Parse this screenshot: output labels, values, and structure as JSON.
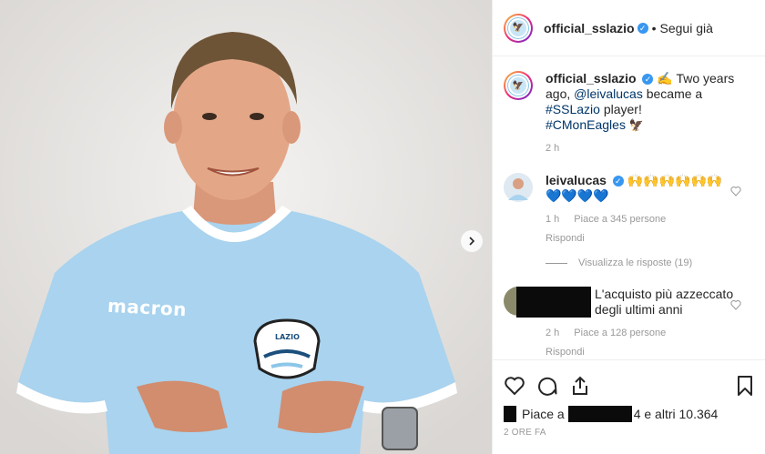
{
  "header": {
    "username": "official_sslazio",
    "separator": "•",
    "follow_status": "Segui già",
    "verified_mark": "✓"
  },
  "photo": {
    "shirt_brand": "macron",
    "crest_text": "LAZIO"
  },
  "caption": {
    "username": "official_sslazio",
    "text_1": "✍️ Two years ago,",
    "mention": "@leivalucas",
    "text_2": " became a ",
    "hashtag_1": "#SSLazio",
    "text_3": " player!",
    "hashtag_2": "#CMonEagles",
    "emoji_end": "🦅",
    "time": "2 h"
  },
  "comments": [
    {
      "username": "leivalucas",
      "text": "🙌🙌🙌🙌🙌🙌 💙💙💙💙",
      "time": "1 h",
      "likes": "Piace a 345 persone",
      "reply": "Rispondi",
      "view_replies": "Visualizza le risposte (19)"
    },
    {
      "text": "L'acquisto più azzeccato degli ultimi anni",
      "time": "2 h",
      "likes": "Piace a 128 persone",
      "reply": "Rispondi"
    }
  ],
  "likes": {
    "prefix": "Piace a",
    "suffix": "4 e altri 10.364"
  },
  "timestamp": "2 ORE FA",
  "colors": {
    "verified": "#3897f0",
    "link": "#003569",
    "muted": "#999999",
    "shirt": "#a9d3ee"
  }
}
